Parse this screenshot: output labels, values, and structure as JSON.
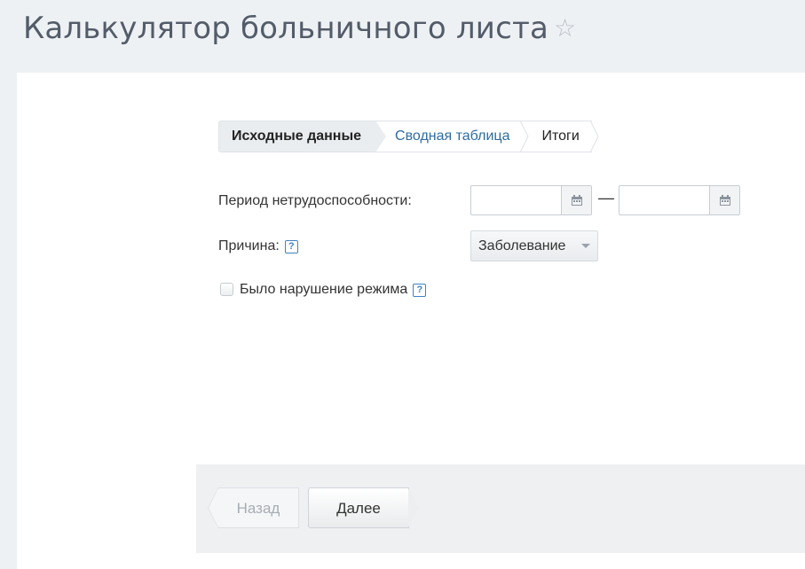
{
  "header": {
    "title": "Калькулятор больничного листа",
    "star": "☆"
  },
  "wizard": {
    "steps": [
      {
        "label": "Исходные данные",
        "state": "active"
      },
      {
        "label": "Сводная таблица",
        "state": "link"
      },
      {
        "label": "Итоги",
        "state": "plain"
      }
    ]
  },
  "form": {
    "period_label": "Период нетрудоспособности:",
    "period_from_value": "",
    "period_to_value": "",
    "period_separator": "—",
    "reason_label": "Причина:",
    "reason_selected": "Заболевание",
    "violation_label": "Было нарушение режима",
    "violation_checked": false,
    "help_glyph": "?"
  },
  "footer": {
    "back_label": "Назад",
    "next_label": "Далее"
  },
  "colors": {
    "title": "#535c69",
    "link": "#2d6ca2",
    "help": "#3f82c4",
    "background": "#eef1f4"
  },
  "icons": [
    "star-icon",
    "calendar-icon",
    "help-icon",
    "chevron-down-icon"
  ]
}
